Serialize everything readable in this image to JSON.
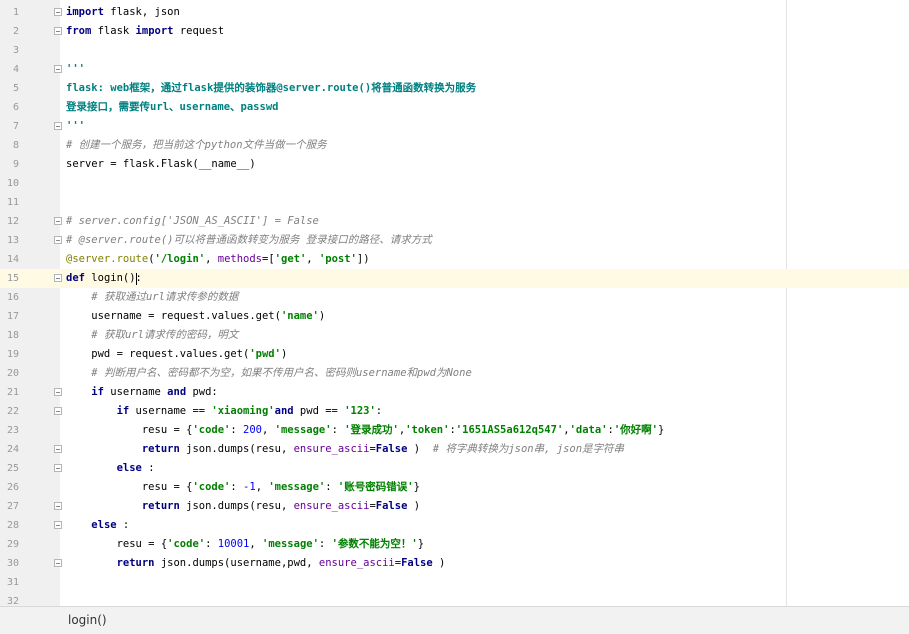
{
  "editor": {
    "current_line": 15,
    "lines": [
      {
        "n": "1",
        "segs": [
          [
            "kw",
            "import"
          ],
          [
            "",
            "flask, json"
          ]
        ],
        "fold": true
      },
      {
        "n": "2",
        "segs": [
          [
            "kw",
            "from"
          ],
          [
            "",
            "flask "
          ],
          [
            "kw",
            "import"
          ],
          [
            "",
            "request"
          ]
        ],
        "fold": true
      },
      {
        "n": "3",
        "segs": [],
        "fold": false
      },
      {
        "n": "4",
        "segs": [
          [
            "doc",
            "'''"
          ]
        ],
        "fold": true
      },
      {
        "n": "5",
        "segs": [
          [
            "doc",
            "flask: web框架，通过flask提供的装饰器@server.route()将普通函数转换为服务"
          ]
        ],
        "fold": false
      },
      {
        "n": "6",
        "segs": [
          [
            "doc",
            "登录接口，需要传url、username、passwd"
          ]
        ],
        "fold": false
      },
      {
        "n": "7",
        "segs": [
          [
            "doc",
            "'''"
          ]
        ],
        "fold": true
      },
      {
        "n": "8",
        "segs": [
          [
            "cmt",
            "# 创建一个服务，把当前这个python文件当做一个服务"
          ]
        ],
        "fold": false
      },
      {
        "n": "9",
        "segs": [
          [
            "",
            "server = flask.Flask(__name__)"
          ]
        ],
        "fold": false
      },
      {
        "n": "10",
        "segs": [],
        "fold": false
      },
      {
        "n": "11",
        "segs": [],
        "fold": false
      },
      {
        "n": "12",
        "segs": [
          [
            "cmt",
            "# server.config['JSON_AS_ASCII'] = False"
          ]
        ],
        "fold": true
      },
      {
        "n": "13",
        "segs": [
          [
            "cmt",
            "# @server.route()可以将普通函数转变为服务 登录接口的路径、请求方式"
          ]
        ],
        "fold": true
      },
      {
        "n": "14",
        "segs": [
          [
            "deco",
            "@server.route"
          ],
          [
            "",
            "("
          ],
          [
            "str",
            "'/login'"
          ],
          [
            "",
            ", "
          ],
          [
            "named",
            "methods"
          ],
          [
            "",
            "=["
          ],
          [
            "str",
            "'get'"
          ],
          [
            "",
            ", "
          ],
          [
            "str",
            "'post'"
          ],
          [
            "",
            "])"
          ]
        ],
        "fold": false
      },
      {
        "n": "15",
        "segs": [
          [
            "kw",
            "def"
          ],
          [
            "",
            "login():"
          ]
        ],
        "fold": true
      },
      {
        "n": "16",
        "segs": [
          [
            "",
            "    "
          ],
          [
            "cmt",
            "# 获取通过url请求传参的数据"
          ]
        ],
        "fold": false
      },
      {
        "n": "17",
        "segs": [
          [
            "",
            "    username = request.values.get("
          ],
          [
            "str",
            "'name'"
          ],
          [
            "",
            ")"
          ]
        ],
        "fold": false
      },
      {
        "n": "18",
        "segs": [
          [
            "",
            "    "
          ],
          [
            "cmt",
            "# 获取url请求传的密码，明文"
          ]
        ],
        "fold": false
      },
      {
        "n": "19",
        "segs": [
          [
            "",
            "    pwd = request.values.get("
          ],
          [
            "str",
            "'pwd'"
          ],
          [
            "",
            ")"
          ]
        ],
        "fold": false
      },
      {
        "n": "20",
        "segs": [
          [
            "",
            "    "
          ],
          [
            "cmt",
            "# 判断用户名、密码都不为空，如果不传用户名、密码则username和pwd为None"
          ]
        ],
        "fold": false
      },
      {
        "n": "21",
        "segs": [
          [
            "",
            "    "
          ],
          [
            "kw",
            "if"
          ],
          [
            "",
            "username "
          ],
          [
            "kw",
            "and"
          ],
          [
            "",
            "pwd:"
          ]
        ],
        "fold": true
      },
      {
        "n": "22",
        "segs": [
          [
            "",
            "        "
          ],
          [
            "kw",
            "if"
          ],
          [
            "",
            "username == "
          ],
          [
            "str",
            "'xiaoming'"
          ],
          [
            "",
            ""
          ],
          [
            "kw",
            "and"
          ],
          [
            "",
            "pwd == "
          ],
          [
            "str",
            "'123'"
          ],
          [
            "",
            ":"
          ]
        ],
        "fold": true
      },
      {
        "n": "23",
        "segs": [
          [
            "",
            "            resu = {"
          ],
          [
            "str",
            "'code'"
          ],
          [
            "",
            ": "
          ],
          [
            "num",
            "200"
          ],
          [
            "",
            ", "
          ],
          [
            "str",
            "'message'"
          ],
          [
            "",
            ": "
          ],
          [
            "str",
            "'登录成功'"
          ],
          [
            "",
            ","
          ],
          [
            "str",
            "'token'"
          ],
          [
            "",
            ":"
          ],
          [
            "str",
            "'1651AS5a612q547'"
          ],
          [
            "",
            ","
          ],
          [
            "str",
            "'data'"
          ],
          [
            "",
            ":"
          ],
          [
            "str",
            "'你好啊'"
          ],
          [
            "",
            "}"
          ]
        ],
        "fold": false
      },
      {
        "n": "24",
        "segs": [
          [
            "",
            "            "
          ],
          [
            "kw",
            "return"
          ],
          [
            "",
            "json.dumps(resu, "
          ],
          [
            "named",
            "ensure_ascii"
          ],
          [
            "",
            "="
          ],
          [
            "kw",
            "False"
          ],
          [
            "",
            ")  "
          ],
          [
            "cmt",
            "# 将字典转换为json串, json是字符串"
          ]
        ],
        "fold": true
      },
      {
        "n": "25",
        "segs": [
          [
            "",
            "        "
          ],
          [
            "kw",
            "else"
          ],
          [
            "",
            ":"
          ]
        ],
        "fold": true
      },
      {
        "n": "26",
        "segs": [
          [
            "",
            "            resu = {"
          ],
          [
            "str",
            "'code'"
          ],
          [
            "",
            ": "
          ],
          [
            "num",
            "-1"
          ],
          [
            "",
            ", "
          ],
          [
            "str",
            "'message'"
          ],
          [
            "",
            ": "
          ],
          [
            "str",
            "'账号密码错误'"
          ],
          [
            "",
            "}"
          ]
        ],
        "fold": false
      },
      {
        "n": "27",
        "segs": [
          [
            "",
            "            "
          ],
          [
            "kw",
            "return"
          ],
          [
            "",
            "json.dumps(resu, "
          ],
          [
            "named",
            "ensure_ascii"
          ],
          [
            "",
            "="
          ],
          [
            "kw",
            "False"
          ],
          [
            "",
            ")"
          ]
        ],
        "fold": true
      },
      {
        "n": "28",
        "segs": [
          [
            "",
            "    "
          ],
          [
            "kw",
            "else"
          ],
          [
            "",
            ":"
          ]
        ],
        "fold": true
      },
      {
        "n": "29",
        "segs": [
          [
            "",
            "        resu = {"
          ],
          [
            "str",
            "'code'"
          ],
          [
            "",
            ": "
          ],
          [
            "num",
            "10001"
          ],
          [
            "",
            ", "
          ],
          [
            "str",
            "'message'"
          ],
          [
            "",
            ": "
          ],
          [
            "str",
            "'参数不能为空！'"
          ],
          [
            "",
            "}"
          ]
        ],
        "fold": false
      },
      {
        "n": "30",
        "segs": [
          [
            "",
            "        "
          ],
          [
            "kw",
            "return"
          ],
          [
            "",
            "json.dumps(username,pwd, "
          ],
          [
            "named",
            "ensure_ascii"
          ],
          [
            "",
            "="
          ],
          [
            "kw",
            "False"
          ],
          [
            "",
            ")"
          ]
        ],
        "fold": true
      },
      {
        "n": "31",
        "segs": [],
        "fold": false
      },
      {
        "n": "32",
        "segs": [],
        "fold": false
      }
    ]
  },
  "status_bar": {
    "breadcrumb": "login()"
  }
}
